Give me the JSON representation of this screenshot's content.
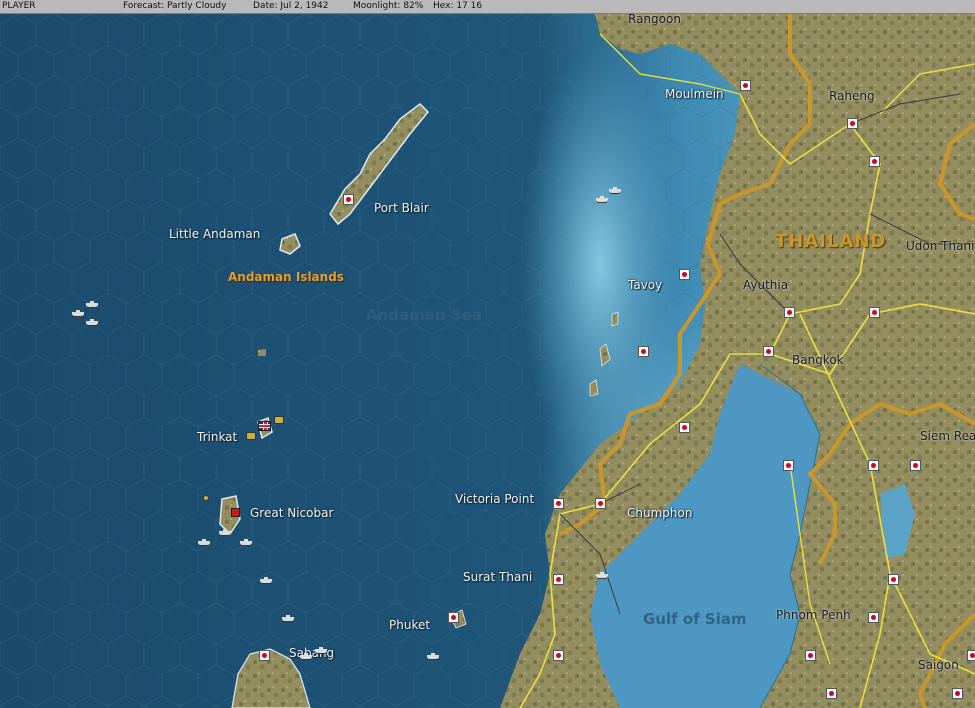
{
  "status_bar": {
    "side": "PLAYER",
    "forecast": "Forecast: Partly Cloudy",
    "date": "Date: Jul 2, 1942",
    "moonlight": "Moonlight: 82%",
    "hex": "Hex: 17 16"
  },
  "colors": {
    "sea_deep": "#1d4f72",
    "sea_shallow": "#6fb6d6",
    "land": "#8f8a5e",
    "border_orange": "#c9962b",
    "road_yellow": "#e8e040",
    "japanese_red": "#d6001c"
  },
  "labels": {
    "rangoon": "Rangoon",
    "moulmein": "Moulmein",
    "raheng": "Raheng",
    "port_blair": "Port Blair",
    "little_andaman": "Little Andaman",
    "andaman_islands": "Andaman Islands",
    "andaman_sea": "Andaman Sea",
    "thailand": "THAILAND",
    "udon_thani": "Udon Thani",
    "tavoy": "Tavoy",
    "ayuthia": "Ayuthia",
    "bangkok": "Bangkok",
    "trinkat": "Trinkat",
    "siem_reap": "Siem Rea",
    "great_nicobar": "Great Nicobar",
    "victoria_point": "Victoria Point",
    "chumphon": "Chumphon",
    "surat_thani": "Surat Thani",
    "gulf_of_siam": "Gulf of Siam",
    "phuket": "Phuket",
    "phnom_penh": "Phnom Penh",
    "sabang": "Sabang",
    "saigon": "Saigon"
  },
  "icons": {
    "base": "japanese-base-icon",
    "ship": "ship-task-force-icon",
    "allied_flag": "british-flag-icon",
    "air_unit": "air-unit-icon",
    "ground_unit": "allied-ground-unit-icon"
  }
}
